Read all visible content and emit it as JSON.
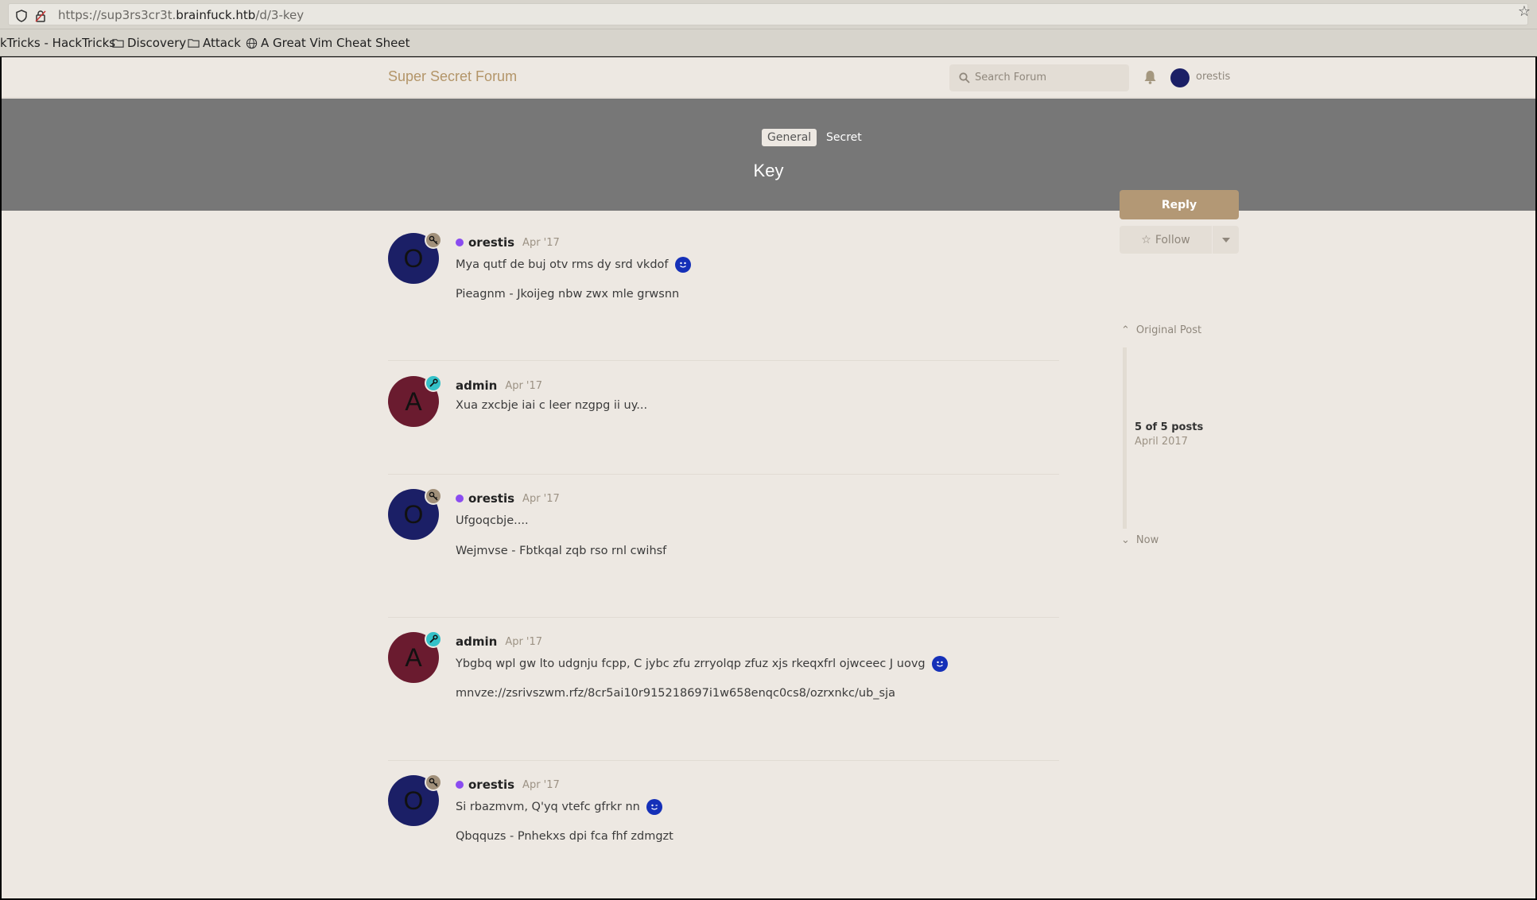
{
  "browser": {
    "url_prefix": "https://sup3rs3cr3t.",
    "url_host": "brainfuck.htb",
    "url_path": "/d/3-key",
    "bookmarks": [
      "kTricks - HackTricks",
      "Discovery",
      "Attack",
      "A Great Vim Cheat Sheet"
    ]
  },
  "header": {
    "brand": "Super Secret Forum",
    "search_placeholder": "Search Forum",
    "username": "orestis"
  },
  "hero": {
    "tags": [
      "General",
      "Secret"
    ],
    "title": "Key"
  },
  "posts": [
    {
      "initial": "O",
      "user": "orestis",
      "date": "Apr '17",
      "lines": [
        "Mya qutf de buj otv rms dy srd vkdof",
        "Pieagnm - Jkoijeg nbw zwx mle grwsnn"
      ]
    },
    {
      "initial": "A",
      "user": "admin",
      "date": "Apr '17",
      "lines": [
        "Xua zxcbje iai c leer nzgpg ii uy..."
      ]
    },
    {
      "initial": "O",
      "user": "orestis",
      "date": "Apr '17",
      "lines": [
        "Ufgoqcbje....",
        "Wejmvse - Fbtkqal zqb rso rnl cwihsf"
      ]
    },
    {
      "initial": "A",
      "user": "admin",
      "date": "Apr '17",
      "lines": [
        "Ybgbq wpl gw lto udgnju fcpp, C jybc zfu zrryolqp zfuz xjs rkeqxfrl ojwceec J uovg",
        "mnvze://zsrivszwm.rfz/8cr5ai10r915218697i1w658enqc0cs8/ozrxnkc/ub_sja"
      ]
    },
    {
      "initial": "O",
      "user": "orestis",
      "date": "Apr '17",
      "lines": [
        "Si rbazmvm, Q'yq vtefc gfrkr nn",
        "Qbqquzs - Pnhekxs dpi fca fhf zdmgzt"
      ]
    }
  ],
  "sidebar": {
    "reply": "Reply",
    "follow": "Follow",
    "original_post": "Original Post",
    "count": "5 of 5 posts",
    "count_date": "April 2017",
    "now": "Now"
  }
}
